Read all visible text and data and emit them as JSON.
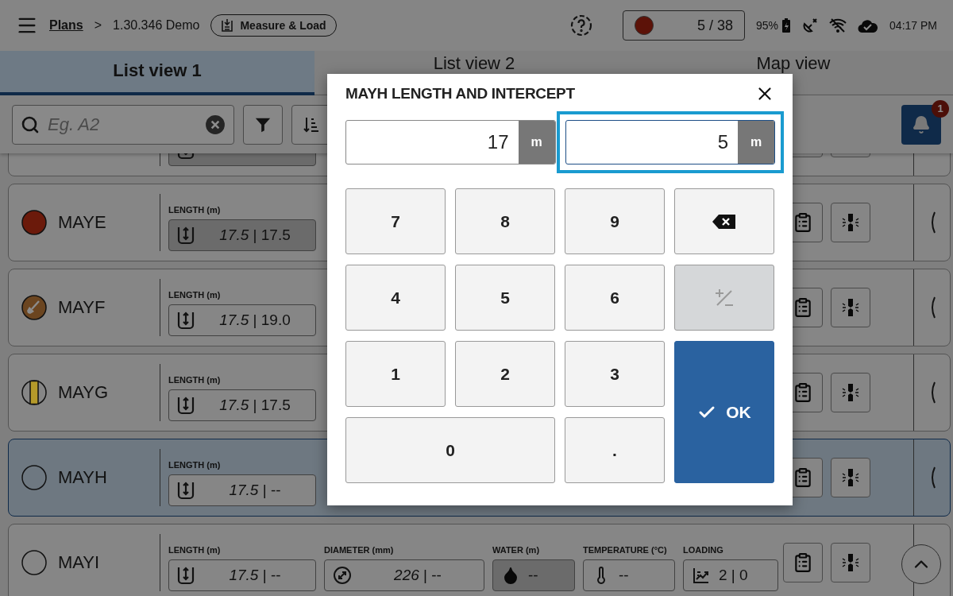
{
  "header": {
    "root": "Plans",
    "separator": ">",
    "project": "1.30.346 Demo",
    "mode": "Measure & Load",
    "progress": {
      "color": "#5c1208",
      "count": "5 / 38"
    },
    "battery": "95%",
    "time": "04:17 PM"
  },
  "tabs": [
    {
      "label": "List view 1",
      "selected": true
    },
    {
      "label": "List view 2",
      "selected": false
    },
    {
      "label": "Map view",
      "selected": false
    }
  ],
  "search": {
    "placeholder": "Eg. A2"
  },
  "notifications": {
    "badge": "1"
  },
  "rows": [
    {
      "kind": "cut",
      "selected": false,
      "handle": false,
      "fields": [
        {
          "kind": "length",
          "highlighted": true
        }
      ]
    },
    {
      "kind": "item",
      "name": "MAYE",
      "selected": false,
      "handle": true,
      "status": {
        "kind": "filled",
        "color": "#6b1a0b"
      },
      "fields": [
        {
          "kind": "length",
          "label": "LENGTH (m)",
          "value": "*17.5* | 17.5",
          "highlighted": true
        }
      ]
    },
    {
      "kind": "item",
      "name": "MAYF",
      "selected": false,
      "handle": true,
      "status": {
        "kind": "shovel",
        "color": "#6b4520"
      },
      "fields": [
        {
          "kind": "length",
          "label": "LENGTH (m)",
          "value": "*17.5* | 19.0",
          "highlighted": false
        }
      ]
    },
    {
      "kind": "item",
      "name": "MAYG",
      "selected": false,
      "handle": true,
      "status": {
        "kind": "half",
        "color": "#b59a2a"
      },
      "fields": [
        {
          "kind": "length",
          "label": "LENGTH (m)",
          "value": "*17.5* | 17.5",
          "highlighted": false
        }
      ]
    },
    {
      "kind": "item",
      "name": "MAYH",
      "selected": true,
      "handle": true,
      "status": {
        "kind": "empty"
      },
      "fields": [
        {
          "kind": "length",
          "label": "LENGTH (m)",
          "value": "*17.5* | --",
          "highlighted": false
        }
      ]
    },
    {
      "kind": "item",
      "name": "MAYI",
      "selected": false,
      "handle": false,
      "status": {
        "kind": "empty"
      },
      "fields": [
        {
          "kind": "length",
          "label": "LENGTH (m)",
          "value": "*17.5* | --",
          "highlighted": false
        },
        {
          "kind": "diameter",
          "label": "DIAMETER (mm)",
          "value": "*226* | --",
          "highlighted": false
        },
        {
          "kind": "water",
          "label": "WATER (m)",
          "value": "--",
          "highlighted": true
        },
        {
          "kind": "temperature",
          "label": "TEMPERATURE (°C)",
          "value": "--",
          "highlighted": false
        },
        {
          "kind": "loading",
          "label": "LOADING",
          "value": "2 | 0",
          "highlighted": false
        }
      ]
    }
  ],
  "dialog": {
    "title": "MAYH LENGTH AND INTERCEPT",
    "fields": [
      {
        "value": "17",
        "unit": "m",
        "focused": false
      },
      {
        "value": "5",
        "unit": "m",
        "focused": true
      }
    ],
    "keys": [
      {
        "kind": "digit",
        "label": "7",
        "disabled": false
      },
      {
        "kind": "digit",
        "label": "8",
        "disabled": false
      },
      {
        "kind": "digit",
        "label": "9",
        "disabled": false
      },
      {
        "kind": "backspace",
        "disabled": false
      },
      {
        "kind": "digit",
        "label": "4",
        "disabled": false
      },
      {
        "kind": "digit",
        "label": "5",
        "disabled": false
      },
      {
        "kind": "digit",
        "label": "6",
        "disabled": false
      },
      {
        "kind": "sign",
        "disabled": true
      },
      {
        "kind": "digit",
        "label": "1",
        "disabled": false
      },
      {
        "kind": "digit",
        "label": "2",
        "disabled": false
      },
      {
        "kind": "digit",
        "label": "3",
        "disabled": false
      },
      {
        "kind": "ok",
        "label": "OK",
        "disabled": false
      },
      {
        "kind": "wide",
        "label": "0",
        "disabled": false
      },
      {
        "kind": "digit",
        "label": ".",
        "disabled": false
      }
    ]
  }
}
